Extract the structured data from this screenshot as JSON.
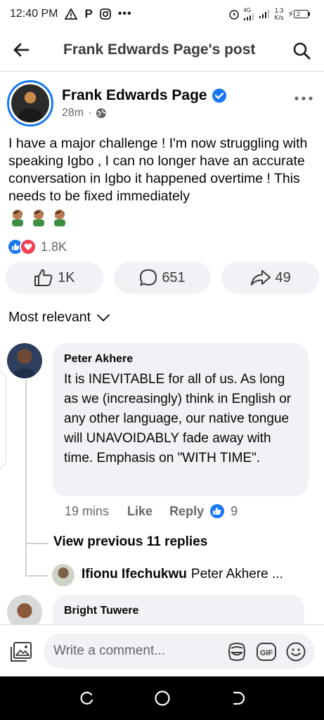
{
  "status_bar": {
    "time": "12:40 PM",
    "network": "4G",
    "speed": "1.3",
    "speed_unit": "K/s",
    "battery": "2"
  },
  "header": {
    "title": "Frank Edwards Page's post"
  },
  "post": {
    "author": "Frank Edwards Page",
    "time": "28m",
    "text": "I have a major challenge ! I'm now struggling with speaking Igbo , I can no longer have an accurate conversation in Igbo it happened overtime ! This needs to be fixed immediately",
    "emoji_count": 3,
    "reactions_count": "1.8K",
    "actions": {
      "like": "1K",
      "comment": "651",
      "share": "49"
    }
  },
  "sort_label": "Most relevant",
  "comments": [
    {
      "author": "Peter Akhere",
      "text": "It is INEVITABLE for all of us. As long as we (increasingly) think in English or any other language, our native tongue will UNAVOIDABLY fade away with time. Emphasis on \"WITH TIME\".",
      "time": "19 mins",
      "like_label": "Like",
      "reply_label": "Reply",
      "like_count": "9",
      "view_previous": "View previous 11 replies",
      "reply_preview": {
        "author": "Ifionu Ifechukwu",
        "text": "Peter Akhere ..."
      }
    },
    {
      "author": "Bright Tuwere"
    }
  ],
  "composer": {
    "placeholder": "Write a comment..."
  },
  "colors": {
    "brand_blue": "#1877f2",
    "love_red": "#f33e58",
    "bubble_bg": "#f0f2f5",
    "secondary_text": "#65676b"
  }
}
